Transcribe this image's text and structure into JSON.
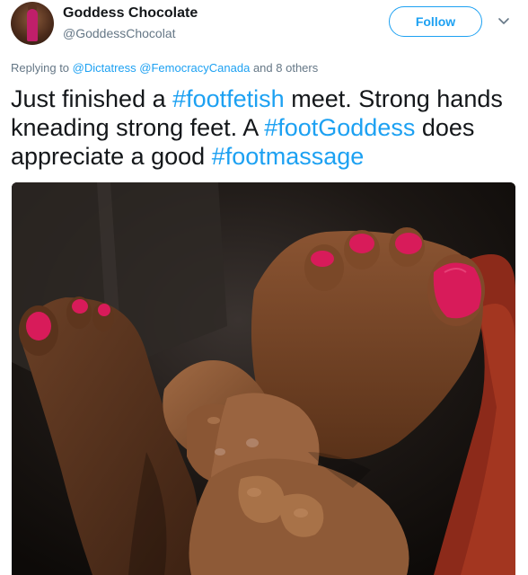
{
  "author": {
    "name": "Goddess Chocolate",
    "handle": "@GoddessChocolat"
  },
  "follow_label": "Follow",
  "reply": {
    "prefix": "Replying to",
    "users": [
      "@Dictatress",
      "@FemocracyCanada"
    ],
    "suffix": "and 8 others"
  },
  "tweet": {
    "segments": [
      {
        "text": "Just finished a ",
        "type": "text"
      },
      {
        "text": "#footfetish",
        "type": "hashtag"
      },
      {
        "text": " meet. Strong hands kneading strong feet. A ",
        "type": "text"
      },
      {
        "text": "#footGoddess",
        "type": "hashtag"
      },
      {
        "text": " does appreciate a good ",
        "type": "text"
      },
      {
        "text": "#footmassage",
        "type": "hashtag"
      }
    ]
  },
  "colors": {
    "link": "#1da1f2",
    "text": "#14171a",
    "secondary": "#657786",
    "nail_polish": "#d81b5a"
  },
  "icons": [
    "chevron-down-icon"
  ]
}
